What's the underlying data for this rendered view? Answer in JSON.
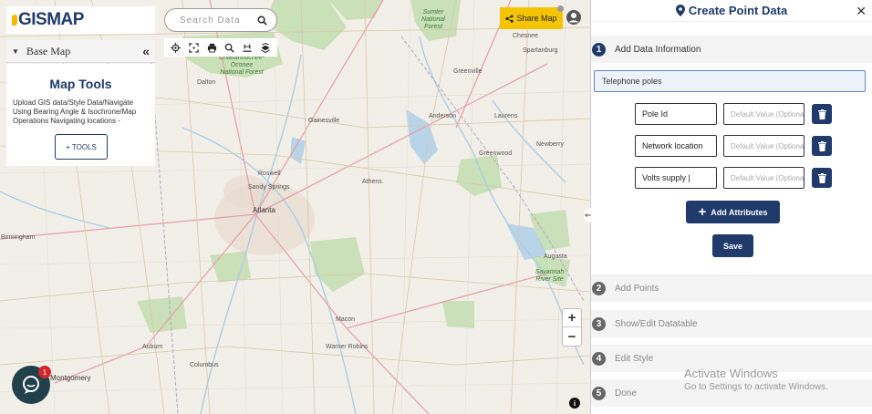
{
  "app": {
    "logo_text": "GISMAP"
  },
  "sidebar": {
    "base_map_label": "Base Map",
    "tools_title": "Map Tools",
    "tools_description": "Upload GIS data/Style Data/Navigate Using Bearing Angle & Isochrone/Map Operations Navigating locations -",
    "tools_button": "+ TOOLS"
  },
  "search": {
    "placeholder": "Search Data"
  },
  "toolbar": {
    "icons": [
      "locate-icon",
      "fullscreen-icon",
      "print-icon",
      "zoom-search-icon",
      "measure-icon",
      "layers-icon"
    ]
  },
  "header": {
    "share_label": "Share Map"
  },
  "map": {
    "zoom_in": "+",
    "zoom_out": "−",
    "info": "i",
    "chat_badge": "1",
    "cities": [
      {
        "name": "Chesnee"
      },
      {
        "name": "Spartanburg"
      },
      {
        "name": "Greenville"
      },
      {
        "name": "Anderson"
      },
      {
        "name": "Laurens"
      },
      {
        "name": "Newberry"
      },
      {
        "name": "Greenwood"
      },
      {
        "name": "Gainesville"
      },
      {
        "name": "Roswell"
      },
      {
        "name": "Sandy Springs"
      },
      {
        "name": "Atlanta"
      },
      {
        "name": "Athens"
      },
      {
        "name": "Birmingham"
      },
      {
        "name": "Macon"
      },
      {
        "name": "Warner Robins"
      },
      {
        "name": "Auburn"
      },
      {
        "name": "Columbus"
      },
      {
        "name": "Montgomery"
      },
      {
        "name": "Dalton"
      },
      {
        "name": "Augusta"
      }
    ],
    "forests": [
      {
        "name": "Chattahoochee-Oconee National Forest"
      },
      {
        "name": "Sumter National Forest"
      },
      {
        "name": "Savannah River Site"
      }
    ]
  },
  "panel": {
    "title": "Create Point Data",
    "close": "✕",
    "steps": [
      {
        "num": "1",
        "label": "Add Data Information"
      },
      {
        "num": "2",
        "label": "Add Points"
      },
      {
        "num": "3",
        "label": "Show/Edit Datatable"
      },
      {
        "num": "4",
        "label": "Edit Style"
      },
      {
        "num": "5",
        "label": "Done"
      }
    ],
    "layer_name": "Telephone poles",
    "attributes": [
      {
        "name": "Pole Id",
        "default_placeholder": "Default Value (Optional)"
      },
      {
        "name": "Network location",
        "default_placeholder": "Default Value (Optional)"
      },
      {
        "name": "Volts supply |",
        "default_placeholder": "Default Value (Optional)"
      }
    ],
    "add_attributes_label": "Add Attributes",
    "save_label": "Save"
  },
  "watermark": {
    "line1": "Activate Windows",
    "line2": "Go to Settings to activate Windows."
  },
  "colors": {
    "brand_navy": "#1f3a6b",
    "share_yellow": "#f5c400",
    "map_bg": "#f2efe9",
    "forest_green": "#b7d9a8"
  }
}
